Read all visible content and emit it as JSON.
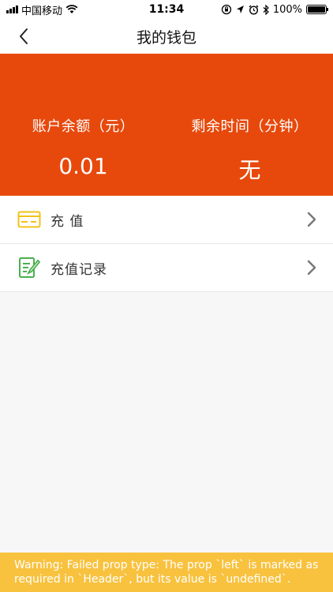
{
  "status_bar": {
    "carrier": "中国移动",
    "time": "11:34",
    "battery": "100%",
    "battery_level": 1.0,
    "icons": [
      "signal-icon",
      "wifi-icon",
      "lock-rotation-icon",
      "location-icon",
      "alarm-icon",
      "bluetooth-icon",
      "battery-icon"
    ]
  },
  "nav": {
    "title": "我的钱包",
    "back_icon": "back-chevron-icon"
  },
  "balance": {
    "account_label": "账户余额（元）",
    "account_value": "0.01",
    "time_label": "剩余时间（分钟）",
    "time_value": "无",
    "background": "#e7490c"
  },
  "menu": {
    "items": [
      {
        "label": "充 值",
        "icon": "card-icon",
        "icon_color": "#f2c21b"
      },
      {
        "label": "充值记录",
        "icon": "record-edit-icon",
        "icon_color": "#4caf50"
      }
    ]
  },
  "warning": {
    "text": "Warning: Failed prop type: The prop `left` is marked as required in `Header`, but its value is `undefined`.",
    "background": "#f8c23f"
  }
}
